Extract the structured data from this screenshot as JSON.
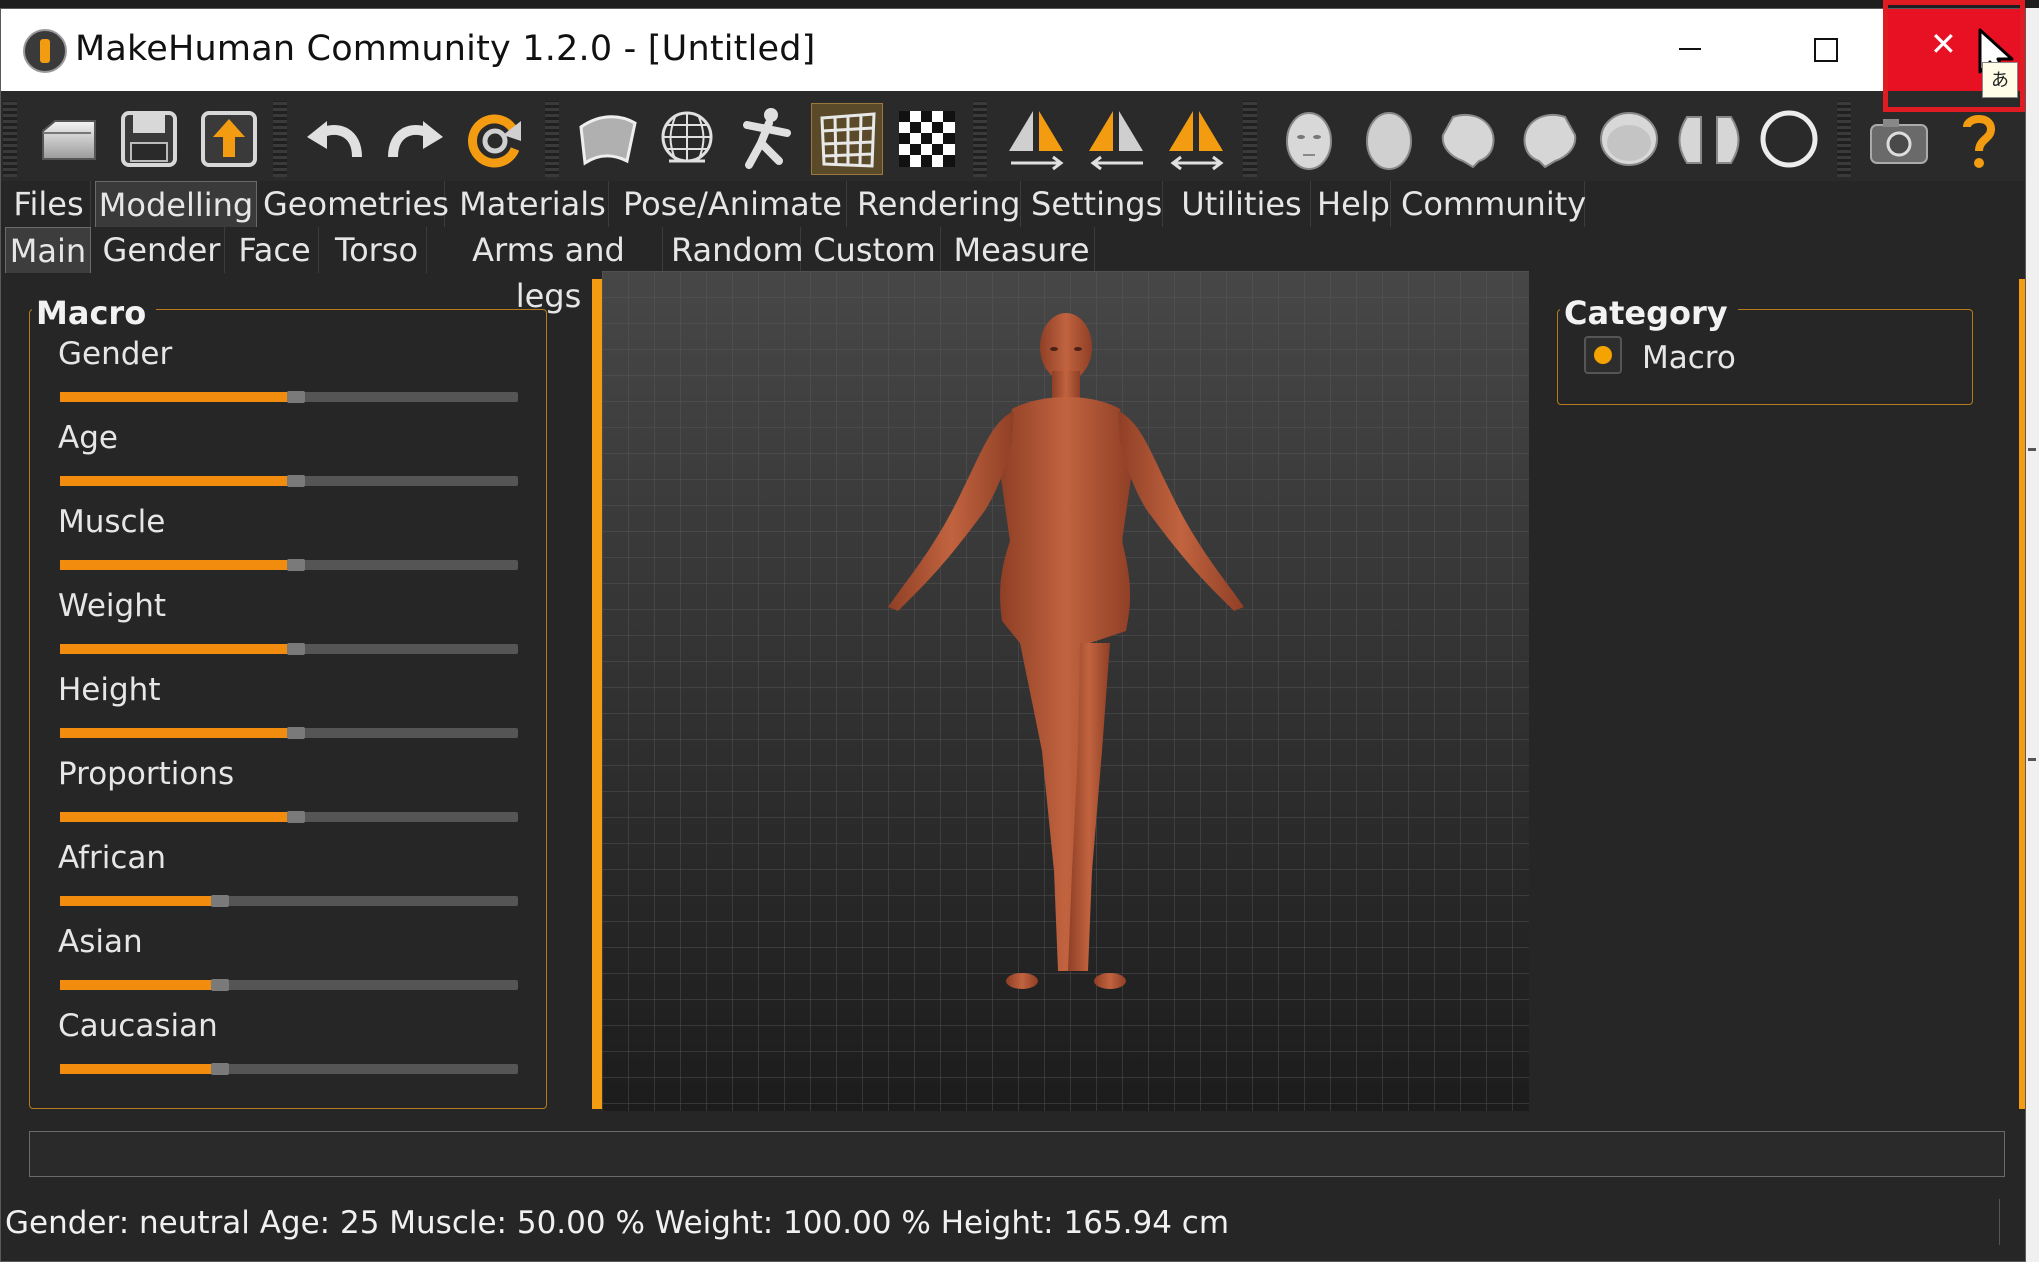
{
  "window": {
    "title": "MakeHuman Community 1.2.0 - [Untitled]",
    "close_symbol": "✕",
    "tooltip_glyph": "あ"
  },
  "toolbar": {
    "icons": [
      "load-icon",
      "save-icon",
      "export-icon",
      "undo-icon",
      "redo-icon",
      "reset-icon",
      "smooth-icon",
      "wireframe-icon",
      "pose-icon",
      "grid-icon",
      "checker-icon",
      "symmetry-right-icon",
      "symmetry-left-icon",
      "symmetry-both-icon",
      "front-view-icon",
      "back-view-icon",
      "left-view-icon",
      "right-view-icon",
      "top-view-icon",
      "bottom-view-icon",
      "global-camera-icon",
      "screenshot-icon",
      "help-icon"
    ]
  },
  "menu": {
    "items": [
      "Files",
      "Modelling",
      "Geometries",
      "Materials",
      "Pose/Animate",
      "Rendering",
      "Settings",
      "Utilities",
      "Help",
      "Community"
    ],
    "active": "Modelling"
  },
  "submenu": {
    "items": [
      "Main",
      "Gender",
      "Face",
      "Torso",
      "Arms and legs",
      "Random",
      "Custom",
      "Measure"
    ],
    "active": "Main"
  },
  "macro": {
    "title": "Macro",
    "sliders": [
      {
        "label": "Gender",
        "value": 0.5
      },
      {
        "label": "Age",
        "value": 0.5
      },
      {
        "label": "Muscle",
        "value": 0.5
      },
      {
        "label": "Weight",
        "value": 0.5
      },
      {
        "label": "Height",
        "value": 0.5
      },
      {
        "label": "Proportions",
        "value": 0.5
      },
      {
        "label": "African",
        "value": 0.333
      },
      {
        "label": "Asian",
        "value": 0.333
      },
      {
        "label": "Caucasian",
        "value": 0.333
      }
    ]
  },
  "category": {
    "title": "Category",
    "option": "Macro"
  },
  "status": {
    "text": "Gender: neutral  Age: 25  Muscle: 50.00 %  Weight: 100.00 %  Height: 165.94 cm"
  },
  "colors": {
    "accent": "#f39c12",
    "close_red": "#e81123",
    "skin": "#b5573a"
  }
}
